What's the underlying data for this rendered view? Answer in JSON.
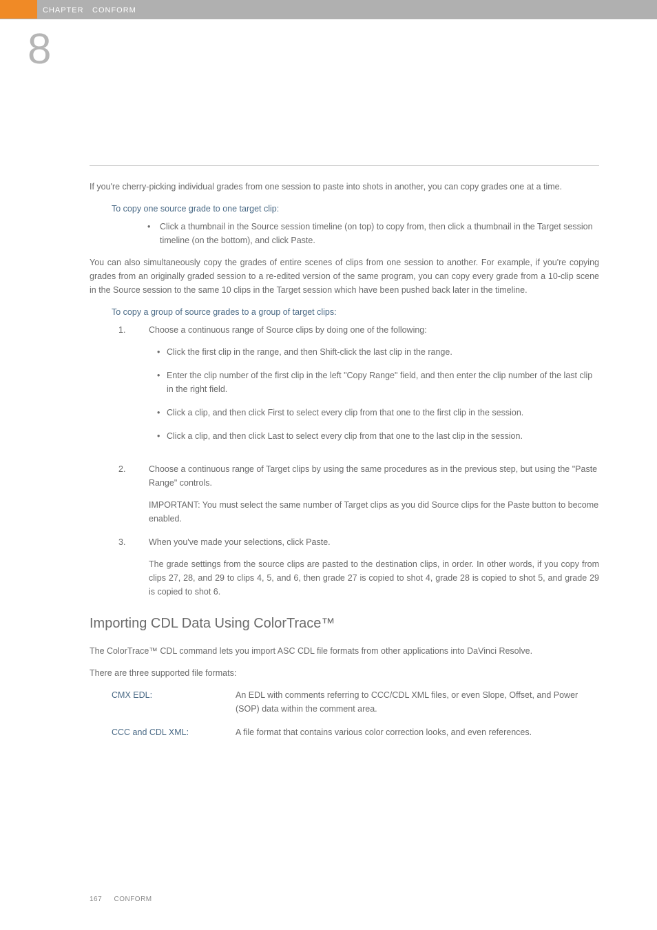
{
  "header": {
    "chapter_label": "CHAPTER",
    "section_label": "CONFORM",
    "chapter_number": "8"
  },
  "intro1": "If you're cherry-picking individual grades from one session to paste into shots in another, you can copy grades one at a time.",
  "sub1": "To copy one source grade to one target clip:",
  "bullet1": "Click a thumbnail in the Source session timeline (on top) to copy from, then click a thumbnail in the Target session timeline (on the bottom), and click Paste.",
  "para2": "You can also simultaneously copy the grades of entire scenes of clips from one session to another. For example, if you're copying grades from an originally graded session to a re-edited version of the same program, you can copy every grade from a 10-clip scene in the Source session to the same 10 clips in the Target session which have been pushed back later in the timeline.",
  "sub2": "To copy a group of source grades to a group of target clips:",
  "steps": {
    "s1": {
      "num": "1.",
      "text": "Choose a continuous range of Source clips by doing one of the following:",
      "b1": "Click the first clip in the range, and then Shift-click the last clip in the range.",
      "b2": "Enter the clip number of the first clip in the left \"Copy Range\" field, and then enter the clip number of the last clip in the right field.",
      "b3": "Click a clip, and then click First to select every clip from that one to the first clip in the session.",
      "b4": "Click a clip, and then click Last to select every clip from that one to the last clip in the session."
    },
    "s2": {
      "num": "2.",
      "text": "Choose a continuous range of Target clips by using the same procedures as in the previous step, but using the \"Paste Range\" controls.",
      "note": "IMPORTANT: You must select the same number of Target clips as you did Source clips for the Paste button to become enabled."
    },
    "s3": {
      "num": "3.",
      "text": "When you've made your selections, click Paste.",
      "note": "The grade settings from the source clips are pasted to the destination clips, in order. In other words, if you copy from clips 27, 28, and 29 to clips 4, 5, and 6, then grade 27 is copied to shot 4, grade 28 is copied to shot 5, and grade 29 is copied to shot 6."
    }
  },
  "h2": "Importing CDL Data Using ColorTrace™",
  "para3": "The ColorTrace™ CDL command lets you import ASC CDL file formats from other applications into DaVinci Resolve.",
  "para4": "There are three supported file formats:",
  "defs": {
    "d1": {
      "term": "CMX EDL:",
      "desc": "An EDL with comments referring to CCC/CDL XML files, or even Slope, Offset, and Power (SOP) data within the comment area."
    },
    "d2": {
      "term": "CCC and CDL XML:",
      "desc": "A file format that contains various color correction looks, and even references."
    }
  },
  "footer": {
    "page": "167",
    "section": "CONFORM"
  }
}
